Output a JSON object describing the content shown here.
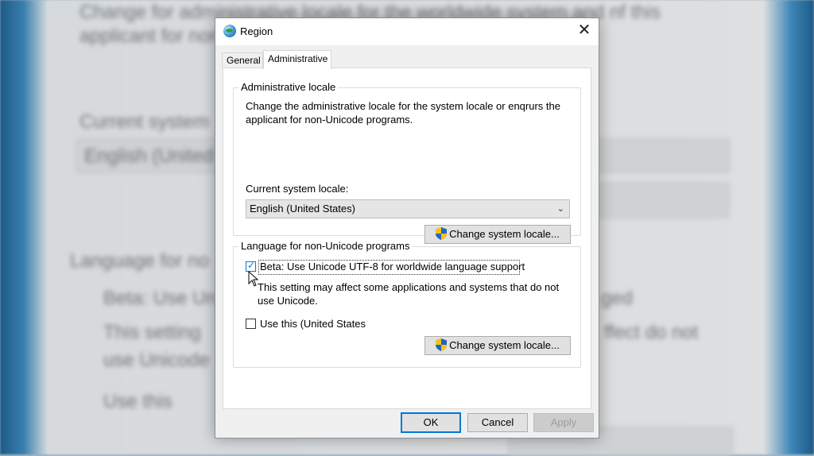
{
  "window": {
    "title": "Region",
    "close_icon": "close-icon"
  },
  "tabs": [
    {
      "label": "General",
      "selected": false
    },
    {
      "label": "Administrative",
      "selected": true
    }
  ],
  "admin_locale_group": {
    "title": "Administrative locale",
    "description": "Change the administrative locale for the system locale or enqrurs the applicant for non-Unicode programs.",
    "current_locale_label": "Current system locale:",
    "current_locale_value": "English (United States)",
    "change_button": "Change system locale..."
  },
  "non_unicode_group": {
    "title": "Language for non-Unicode programs",
    "beta_checkbox_label": "Beta: Use Unicode UTF-8 for worldwide language support",
    "beta_checked": true,
    "note": "This setting may affect some applications and systems that do not use Unicode.",
    "use_this_label": "Use this (United States",
    "use_this_checked": false,
    "change_button": "Change system locale..."
  },
  "footer": {
    "ok": "OK",
    "cancel": "Cancel",
    "apply": "Apply"
  },
  "background": {
    "ghost_texts": [
      "Change for administrative locale for the worldwide system and nf this",
      "applicant for non",
      "Current system",
      "English (United",
      "Language for no",
      "Beta: Use Un",
      "This setting",
      "use Unicode",
      "Use this",
      "ged",
      "ffect do not"
    ]
  }
}
